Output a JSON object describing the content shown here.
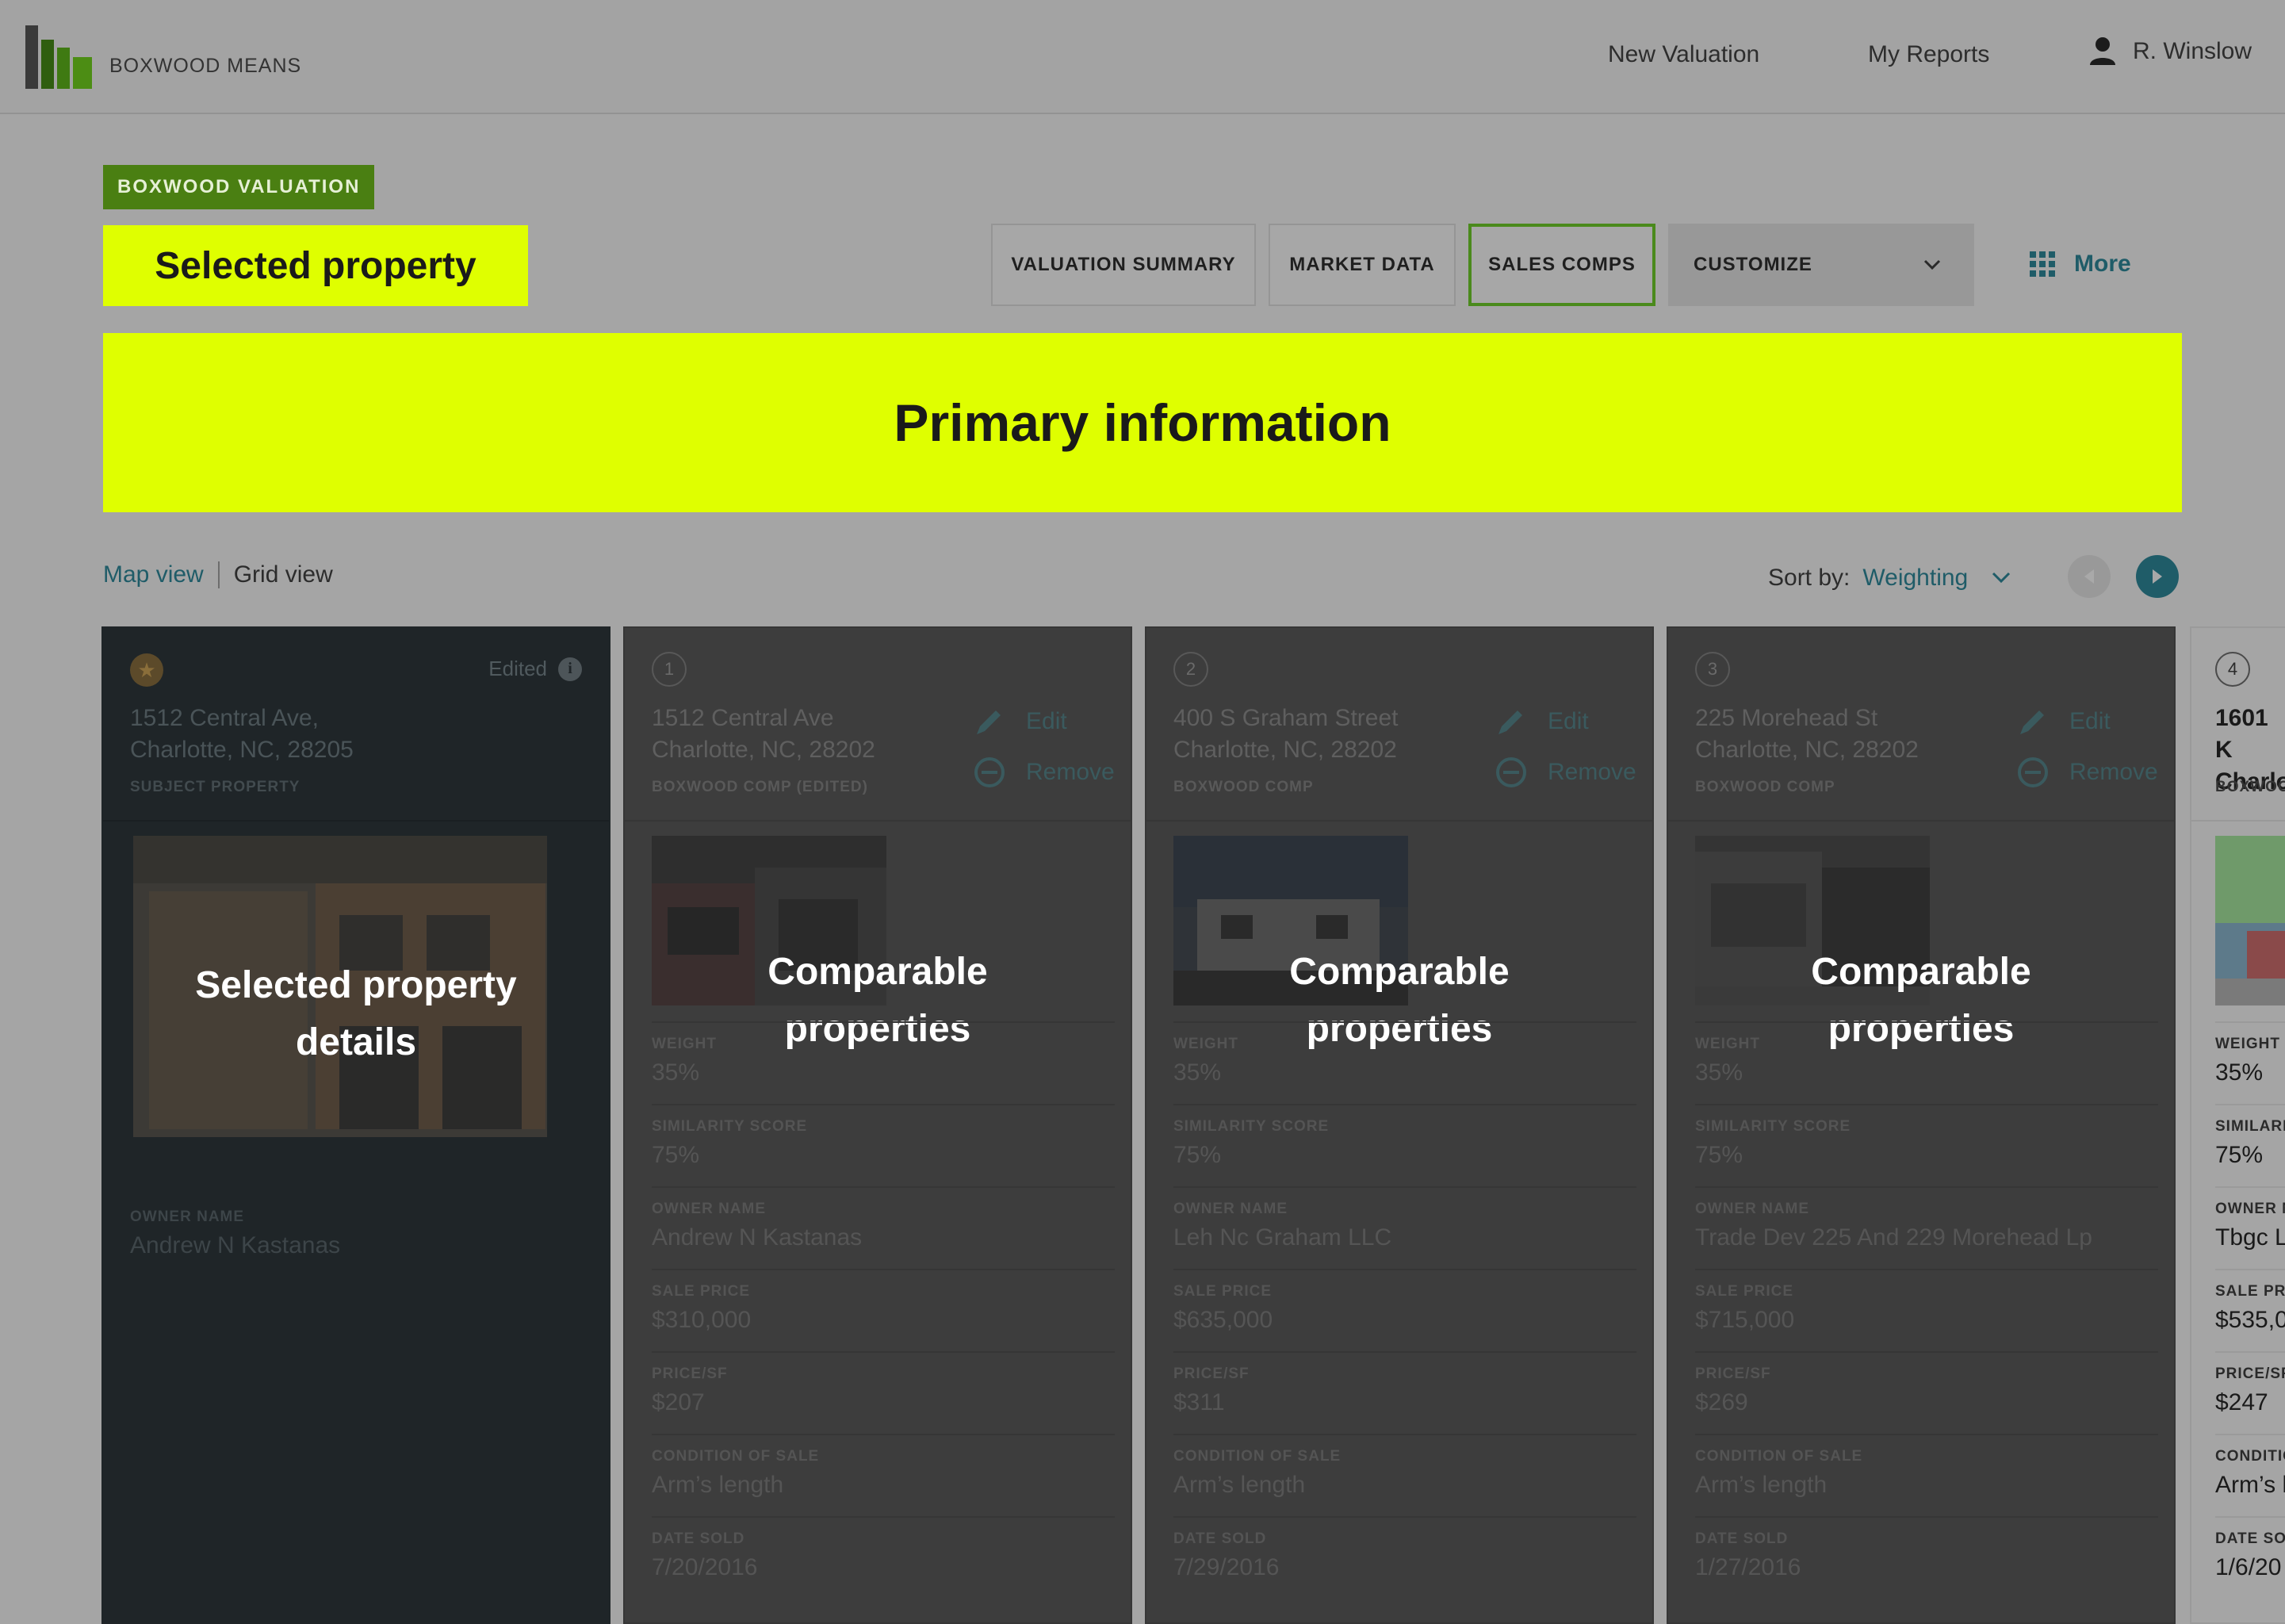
{
  "header": {
    "brand": "BOXWOOD MEANS",
    "nav": [
      "New Valuation",
      "My Reports"
    ],
    "user_name": "R. Winslow"
  },
  "badge": "BOXWOOD VALUATION",
  "highlight_small": "Selected property",
  "tabs": [
    {
      "label": "VALUATION SUMMARY"
    },
    {
      "label": "MARKET DATA"
    },
    {
      "label": "SALES COMPS"
    },
    {
      "label": "CUSTOMIZE"
    }
  ],
  "more_label": "More",
  "highlight_big": "Primary information",
  "view_toggle": {
    "map": "Map view",
    "grid": "Grid view"
  },
  "sort": {
    "label": "Sort by:",
    "value": "Weighting"
  },
  "subject": {
    "edited_label": "Edited",
    "address_line1": "1512 Central Ave,",
    "address_line2": "Charlotte, NC, 28205",
    "type_label": "SUBJECT PROPERTY",
    "overlay_line1": "Selected property",
    "overlay_line2": "details",
    "owner_label": "OWNER NAME",
    "owner_value": "Andrew N Kastanas"
  },
  "actions": {
    "edit": "Edit",
    "remove": "Remove"
  },
  "comp_overlay": {
    "line1": "Comparable",
    "line2": "properties"
  },
  "comps": [
    {
      "number": "1",
      "address_line1": "1512 Central Ave",
      "address_line2": "Charlotte, NC, 28202",
      "type_label": "BOXWOOD COMP (EDITED)",
      "fields": [
        {
          "label": "WEIGHT",
          "value": "35%"
        },
        {
          "label": "SIMILARITY SCORE",
          "value": "75%"
        },
        {
          "label": "OWNER NAME",
          "value": "Andrew N Kastanas"
        },
        {
          "label": "SALE PRICE",
          "value": "$310,000"
        },
        {
          "label": "PRICE/SF",
          "value": "$207"
        },
        {
          "label": "CONDITION OF SALE",
          "value": "Arm’s length"
        },
        {
          "label": "DATE SOLD",
          "value": "7/20/2016"
        }
      ]
    },
    {
      "number": "2",
      "address_line1": "400 S Graham Street",
      "address_line2": "Charlotte, NC, 28202",
      "type_label": "BOXWOOD COMP",
      "fields": [
        {
          "label": "WEIGHT",
          "value": "35%"
        },
        {
          "label": "SIMILARITY SCORE",
          "value": "75%"
        },
        {
          "label": "OWNER NAME",
          "value": "Leh Nc Graham LLC"
        },
        {
          "label": "SALE PRICE",
          "value": "$635,000"
        },
        {
          "label": "PRICE/SF",
          "value": "$311"
        },
        {
          "label": "CONDITION OF SALE",
          "value": "Arm’s length"
        },
        {
          "label": "DATE SOLD",
          "value": "7/29/2016"
        }
      ]
    },
    {
      "number": "3",
      "address_line1": "225 Morehead St",
      "address_line2": "Charlotte, NC, 28202",
      "type_label": "BOXWOOD COMP",
      "fields": [
        {
          "label": "WEIGHT",
          "value": "35%"
        },
        {
          "label": "SIMILARITY SCORE",
          "value": "75%"
        },
        {
          "label": "OWNER NAME",
          "value": "Trade Dev 225 And 229 Morehead Lp"
        },
        {
          "label": "SALE PRICE",
          "value": "$715,000"
        },
        {
          "label": "PRICE/SF",
          "value": "$269"
        },
        {
          "label": "CONDITION OF SALE",
          "value": "Arm’s length"
        },
        {
          "label": "DATE SOLD",
          "value": "1/27/2016"
        }
      ]
    },
    {
      "number": "4",
      "address_line1": "1601 K",
      "address_line2": "Charlo",
      "type_label": "BOXWOOD",
      "fields": [
        {
          "label": "WEIGHT",
          "value": "35%"
        },
        {
          "label": "SIMILARIT",
          "value": "75%"
        },
        {
          "label": "OWNER N",
          "value": "Tbgc L"
        },
        {
          "label": "SALE PRIC",
          "value": "$535,0"
        },
        {
          "label": "PRICE/SF",
          "value": "$247"
        },
        {
          "label": "CONDITIO",
          "value": "Arm’s l"
        },
        {
          "label": "DATE SOL",
          "value": "1/6/20"
        }
      ]
    }
  ]
}
